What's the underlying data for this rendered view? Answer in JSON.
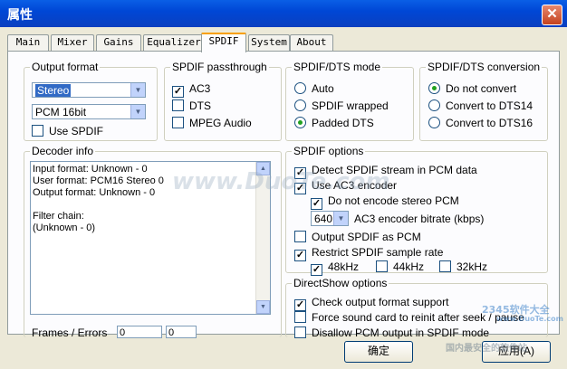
{
  "window": {
    "title": "属性",
    "close_glyph": "✕"
  },
  "tabs": [
    "Main",
    "Mixer",
    "Gains",
    "Equalizer",
    "SPDIF",
    "System",
    "About"
  ],
  "active_tab": "SPDIF",
  "output_format": {
    "label": "Output format",
    "format_value": "Stereo",
    "bits_value": "PCM 16bit",
    "use_spdif_label": "Use SPDIF",
    "use_spdif_checked": false
  },
  "passthrough": {
    "label": "SPDIF passthrough",
    "items": [
      {
        "label": "AC3",
        "checked": true
      },
      {
        "label": "DTS",
        "checked": false
      },
      {
        "label": "MPEG Audio",
        "checked": false
      }
    ]
  },
  "dts_mode": {
    "label": "SPDIF/DTS mode",
    "items": [
      {
        "label": "Auto",
        "selected": false
      },
      {
        "label": "SPDIF wrapped",
        "selected": false
      },
      {
        "label": "Padded DTS",
        "selected": true
      }
    ]
  },
  "dts_conversion": {
    "label": "SPDIF/DTS conversion",
    "items": [
      {
        "label": "Do not convert",
        "selected": true
      },
      {
        "label": "Convert to DTS14",
        "selected": false
      },
      {
        "label": "Convert to DTS16",
        "selected": false
      }
    ]
  },
  "decoder_info": {
    "label": "Decoder info",
    "text": "Input format: Unknown - 0\nUser format: PCM16 Stereo 0\nOutput format: Unknown - 0\n\nFilter chain:\n(Unknown - 0)",
    "frames_label": "Frames / Errors",
    "frames_value": "0",
    "errors_value": "0"
  },
  "spdif_options": {
    "label": "SPDIF options",
    "detect": "Detect SPDIF stream in PCM data",
    "use_ac3": "Use AC3 encoder",
    "no_stereo": "Do not encode stereo PCM",
    "bitrate_value": "640",
    "bitrate_label": "AC3 encoder bitrate (kbps)",
    "output_pcm": "Output SPDIF as PCM",
    "restrict": "Restrict SPDIF sample rate",
    "rate_48": "48kHz",
    "rate_44": "44kHz",
    "rate_32": "32kHz"
  },
  "directshow": {
    "label": "DirectShow options",
    "check_format": "Check output format support",
    "force_reinit": "Force sound card to reinit after seek / pause",
    "disallow_pcm": "Disallow PCM output in SPDIF mode"
  },
  "buttons": {
    "ok": "确定",
    "apply": "应用(A)"
  },
  "watermarks": {
    "duote": "www.DuoTe.com",
    "brand": "2345软件大全",
    "brand_url": "www.DuoTe.com",
    "brand_sub": "国内最安全的软件站"
  }
}
